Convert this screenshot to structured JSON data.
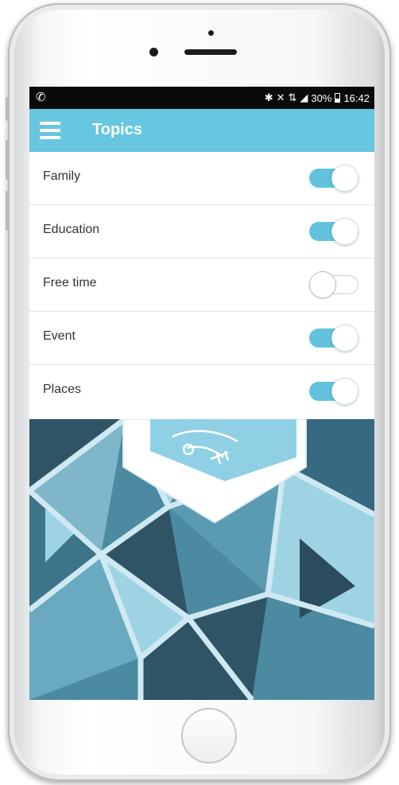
{
  "status_bar": {
    "left_icon": "whatsapp-icon",
    "right_icons": [
      "bluetooth-icon",
      "mute-icon",
      "data-icon",
      "signal-icon"
    ],
    "battery": "30%",
    "time": "16:42"
  },
  "toolbar": {
    "menu_icon": "hamburger-icon",
    "title": "Topics",
    "color": "#67c6e0"
  },
  "topics": [
    {
      "label": "Family",
      "enabled": true
    },
    {
      "label": "Education",
      "enabled": true
    },
    {
      "label": "Free time",
      "enabled": false
    },
    {
      "label": "Event",
      "enabled": true
    },
    {
      "label": "Places",
      "enabled": true
    }
  ],
  "colors": {
    "switch_on": "#63c2dd",
    "pattern_dark": "#2f5466",
    "pattern_mid": "#4b8aa1",
    "pattern_light": "#9ed3e4"
  }
}
